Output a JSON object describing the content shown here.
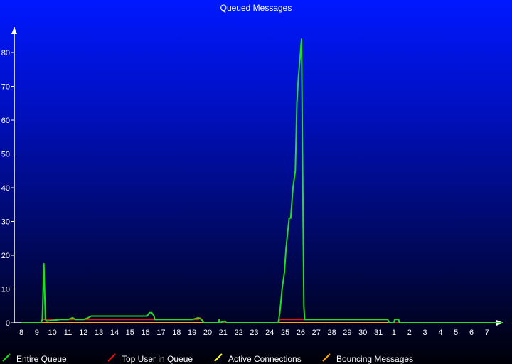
{
  "chart_data": {
    "type": "line",
    "title": "Queued Messages",
    "xlabel": "",
    "ylabel": "",
    "x_ticks": [
      "8",
      "9",
      "10",
      "11",
      "12",
      "13",
      "14",
      "15",
      "16",
      "17",
      "18",
      "19",
      "20",
      "21",
      "22",
      "23",
      "24",
      "25",
      "26",
      "27",
      "28",
      "29",
      "30",
      "31",
      "1",
      "2",
      "3",
      "4",
      "5",
      "6",
      "7"
    ],
    "x_range": [
      8,
      39
    ],
    "y_ticks": [
      0,
      10,
      20,
      30,
      40,
      50,
      60,
      70,
      80
    ],
    "ylim": [
      0,
      85
    ],
    "grid": false,
    "legend_position": "bottom",
    "series": [
      {
        "name": "Entire Queue",
        "color": "#22dd22",
        "points": [
          [
            8.0,
            0
          ],
          [
            9.25,
            0
          ],
          [
            9.35,
            1
          ],
          [
            9.45,
            17.5
          ],
          [
            9.55,
            1
          ],
          [
            9.65,
            0.5
          ],
          [
            10.5,
            1
          ],
          [
            11.0,
            1
          ],
          [
            11.3,
            1.5
          ],
          [
            11.5,
            1
          ],
          [
            12.0,
            1
          ],
          [
            12.3,
            1.5
          ],
          [
            12.5,
            2
          ],
          [
            13.0,
            2
          ],
          [
            14.0,
            2
          ],
          [
            15.0,
            2
          ],
          [
            15.2,
            2
          ],
          [
            15.8,
            2
          ],
          [
            16.1,
            2
          ],
          [
            16.25,
            3
          ],
          [
            16.4,
            3
          ],
          [
            16.55,
            2
          ],
          [
            16.6,
            1
          ],
          [
            17.0,
            1
          ],
          [
            18.0,
            1
          ],
          [
            19.0,
            1
          ],
          [
            19.4,
            1.5
          ],
          [
            19.6,
            1
          ],
          [
            19.75,
            0
          ],
          [
            20.7,
            0
          ],
          [
            20.75,
            1
          ],
          [
            20.8,
            0
          ],
          [
            21.1,
            0.5
          ],
          [
            21.2,
            0
          ],
          [
            24.55,
            0
          ],
          [
            24.65,
            3
          ],
          [
            24.8,
            10
          ],
          [
            24.95,
            15
          ],
          [
            25.05,
            22
          ],
          [
            25.25,
            31
          ],
          [
            25.35,
            31
          ],
          [
            25.5,
            40
          ],
          [
            25.65,
            45
          ],
          [
            25.75,
            65
          ],
          [
            25.85,
            73
          ],
          [
            25.95,
            78
          ],
          [
            26.05,
            84
          ],
          [
            26.2,
            5
          ],
          [
            26.25,
            1
          ],
          [
            31.6,
            1
          ],
          [
            31.7,
            0
          ],
          [
            32.0,
            0
          ],
          [
            32.05,
            1
          ],
          [
            32.3,
            1
          ],
          [
            32.35,
            0
          ],
          [
            39.0,
            0
          ]
        ]
      },
      {
        "name": "Top User in Queue",
        "color": "#ee1111",
        "points": [
          [
            8.0,
            0
          ],
          [
            9.25,
            0
          ],
          [
            9.35,
            1
          ],
          [
            19.4,
            1
          ],
          [
            19.5,
            1.5
          ],
          [
            19.65,
            1
          ],
          [
            19.75,
            0
          ],
          [
            24.55,
            0
          ],
          [
            24.65,
            1
          ],
          [
            31.6,
            1
          ],
          [
            31.7,
            0
          ],
          [
            39.0,
            0
          ]
        ]
      },
      {
        "name": "Active Connections",
        "color": "#ffff22",
        "points": [
          [
            8.0,
            0
          ],
          [
            39.0,
            0
          ]
        ]
      },
      {
        "name": "Bouncing Messages",
        "color": "#ffaa00",
        "points": [
          [
            8.0,
            0
          ],
          [
            39.0,
            0
          ]
        ]
      }
    ]
  }
}
